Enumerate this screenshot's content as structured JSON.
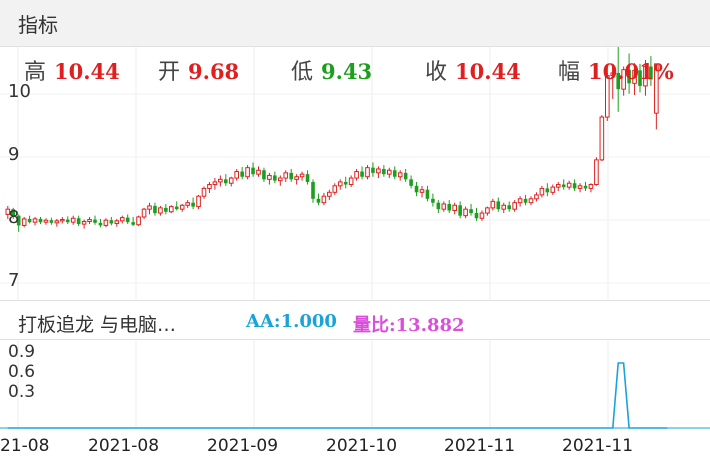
{
  "header": {
    "title": "指标"
  },
  "ohlc": {
    "high_label": "高",
    "high_value": "10.44",
    "open_label": "开",
    "open_value": "9.68",
    "low_label": "低",
    "low_value": "9.43",
    "close_label": "收",
    "close_value": "10.44",
    "range_label": "幅",
    "range_value": "10.01%"
  },
  "colors": {
    "up": "#e02020",
    "down": "#1e9e1e",
    "indicator_line": "#1aa3d9",
    "ratio": "#d94fd9"
  },
  "price_axis": {
    "labels": [
      "10",
      "9",
      "8",
      "7"
    ]
  },
  "indicator": {
    "name": "打板追龙 与电脑…",
    "aa_text": "AA:1.000",
    "ratio_text": "量比:13.882",
    "axis_labels": [
      "0.9",
      "0.6",
      "0.3"
    ]
  },
  "x_axis": {
    "labels": [
      "21-08",
      "2021-08",
      "2021-09",
      "2021-10",
      "2021-11",
      "2021-11"
    ]
  },
  "chart_data": {
    "type": "candlestick",
    "ylim": [
      6.8,
      10.7
    ],
    "candles": [
      [
        8.12,
        8.25,
        8.05,
        8.2
      ],
      [
        8.2,
        8.22,
        8.05,
        8.1
      ],
      [
        8.1,
        8.12,
        7.85,
        7.95
      ],
      [
        7.95,
        8.08,
        7.92,
        8.05
      ],
      [
        8.05,
        8.1,
        7.98,
        8.0
      ],
      [
        8.0,
        8.08,
        7.95,
        8.05
      ],
      [
        8.05,
        8.08,
        7.97,
        8.0
      ],
      [
        8.0,
        8.06,
        7.96,
        8.03
      ],
      [
        8.03,
        8.07,
        7.96,
        7.99
      ],
      [
        7.99,
        8.05,
        7.93,
        8.02
      ],
      [
        8.02,
        8.08,
        7.98,
        8.04
      ],
      [
        8.04,
        8.09,
        7.97,
        8.0
      ],
      [
        8.0,
        8.1,
        7.96,
        8.06
      ],
      [
        8.06,
        8.1,
        7.94,
        7.97
      ],
      [
        7.97,
        8.04,
        7.9,
        8.01
      ],
      [
        8.01,
        8.08,
        7.97,
        8.04
      ],
      [
        8.04,
        8.1,
        7.96,
        7.99
      ],
      [
        7.99,
        8.05,
        7.92,
        7.95
      ],
      [
        7.95,
        8.06,
        7.92,
        8.03
      ],
      [
        8.03,
        8.08,
        7.95,
        7.98
      ],
      [
        7.98,
        8.05,
        7.93,
        8.02
      ],
      [
        8.02,
        8.1,
        7.98,
        8.07
      ],
      [
        8.07,
        8.12,
        7.97,
        8.0
      ],
      [
        8.0,
        8.08,
        7.94,
        7.96
      ],
      [
        7.96,
        8.1,
        7.94,
        8.08
      ],
      [
        8.08,
        8.22,
        8.05,
        8.2
      ],
      [
        8.2,
        8.3,
        8.12,
        8.25
      ],
      [
        8.25,
        8.3,
        8.1,
        8.14
      ],
      [
        8.14,
        8.25,
        8.1,
        8.22
      ],
      [
        8.22,
        8.28,
        8.12,
        8.16
      ],
      [
        8.16,
        8.26,
        8.14,
        8.24
      ],
      [
        8.24,
        8.32,
        8.18,
        8.2
      ],
      [
        8.2,
        8.28,
        8.16,
        8.26
      ],
      [
        8.26,
        8.34,
        8.22,
        8.3
      ],
      [
        8.3,
        8.38,
        8.2,
        8.24
      ],
      [
        8.24,
        8.42,
        8.2,
        8.4
      ],
      [
        8.4,
        8.55,
        8.36,
        8.52
      ],
      [
        8.52,
        8.62,
        8.45,
        8.58
      ],
      [
        8.58,
        8.68,
        8.5,
        8.62
      ],
      [
        8.62,
        8.72,
        8.55,
        8.66
      ],
      [
        8.66,
        8.74,
        8.56,
        8.6
      ],
      [
        8.6,
        8.7,
        8.55,
        8.68
      ],
      [
        8.68,
        8.82,
        8.64,
        8.78
      ],
      [
        8.78,
        8.85,
        8.66,
        8.7
      ],
      [
        8.7,
        8.88,
        8.66,
        8.84
      ],
      [
        8.84,
        8.92,
        8.7,
        8.74
      ],
      [
        8.74,
        8.86,
        8.7,
        8.8
      ],
      [
        8.8,
        8.84,
        8.62,
        8.66
      ],
      [
        8.66,
        8.76,
        8.58,
        8.72
      ],
      [
        8.72,
        8.78,
        8.6,
        8.64
      ],
      [
        8.64,
        8.72,
        8.56,
        8.68
      ],
      [
        8.68,
        8.8,
        8.62,
        8.76
      ],
      [
        8.76,
        8.82,
        8.62,
        8.66
      ],
      [
        8.66,
        8.74,
        8.58,
        8.7
      ],
      [
        8.7,
        8.78,
        8.64,
        8.74
      ],
      [
        8.74,
        8.8,
        8.58,
        8.62
      ],
      [
        8.62,
        8.66,
        8.3,
        8.36
      ],
      [
        8.36,
        8.44,
        8.26,
        8.3
      ],
      [
        8.3,
        8.45,
        8.26,
        8.4
      ],
      [
        8.4,
        8.5,
        8.34,
        8.46
      ],
      [
        8.46,
        8.6,
        8.42,
        8.56
      ],
      [
        8.56,
        8.66,
        8.5,
        8.62
      ],
      [
        8.62,
        8.7,
        8.52,
        8.58
      ],
      [
        8.58,
        8.72,
        8.54,
        8.68
      ],
      [
        8.68,
        8.82,
        8.64,
        8.78
      ],
      [
        8.78,
        8.86,
        8.66,
        8.7
      ],
      [
        8.7,
        8.88,
        8.66,
        8.84
      ],
      [
        8.84,
        8.92,
        8.7,
        8.76
      ],
      [
        8.76,
        8.86,
        8.68,
        8.82
      ],
      [
        8.82,
        8.88,
        8.7,
        8.74
      ],
      [
        8.74,
        8.84,
        8.68,
        8.8
      ],
      [
        8.8,
        8.86,
        8.66,
        8.7
      ],
      [
        8.7,
        8.8,
        8.64,
        8.76
      ],
      [
        8.76,
        8.82,
        8.62,
        8.66
      ],
      [
        8.66,
        8.72,
        8.52,
        8.56
      ],
      [
        8.56,
        8.62,
        8.4,
        8.46
      ],
      [
        8.46,
        8.56,
        8.38,
        8.5
      ],
      [
        8.5,
        8.56,
        8.32,
        8.36
      ],
      [
        8.36,
        8.44,
        8.24,
        8.3
      ],
      [
        8.3,
        8.34,
        8.14,
        8.2
      ],
      [
        8.2,
        8.32,
        8.16,
        8.28
      ],
      [
        8.28,
        8.34,
        8.14,
        8.18
      ],
      [
        8.18,
        8.3,
        8.12,
        8.26
      ],
      [
        8.26,
        8.32,
        8.06,
        8.1
      ],
      [
        8.1,
        8.24,
        8.06,
        8.2
      ],
      [
        8.2,
        8.28,
        8.1,
        8.14
      ],
      [
        8.14,
        8.22,
        8.02,
        8.06
      ],
      [
        8.06,
        8.18,
        8.02,
        8.14
      ],
      [
        8.14,
        8.24,
        8.1,
        8.22
      ],
      [
        8.22,
        8.36,
        8.18,
        8.32
      ],
      [
        8.32,
        8.38,
        8.16,
        8.2
      ],
      [
        8.2,
        8.3,
        8.14,
        8.26
      ],
      [
        8.26,
        8.32,
        8.16,
        8.2
      ],
      [
        8.2,
        8.34,
        8.16,
        8.3
      ],
      [
        8.3,
        8.4,
        8.24,
        8.36
      ],
      [
        8.36,
        8.42,
        8.26,
        8.3
      ],
      [
        8.3,
        8.4,
        8.26,
        8.36
      ],
      [
        8.36,
        8.46,
        8.32,
        8.42
      ],
      [
        8.42,
        8.56,
        8.38,
        8.52
      ],
      [
        8.52,
        8.6,
        8.4,
        8.46
      ],
      [
        8.46,
        8.58,
        8.42,
        8.54
      ],
      [
        8.54,
        8.62,
        8.48,
        8.58
      ],
      [
        8.58,
        8.66,
        8.5,
        8.54
      ],
      [
        8.54,
        8.64,
        8.5,
        8.6
      ],
      [
        8.6,
        8.66,
        8.48,
        8.52
      ],
      [
        8.52,
        8.6,
        8.46,
        8.56
      ],
      [
        8.56,
        8.62,
        8.48,
        8.52
      ],
      [
        8.52,
        8.6,
        8.46,
        8.58
      ],
      [
        8.58,
        9.0,
        8.56,
        8.96
      ],
      [
        8.96,
        9.65,
        8.94,
        9.62
      ],
      [
        9.62,
        10.3,
        9.56,
        10.26
      ],
      [
        10.26,
        10.44,
        9.9,
        10.3
      ],
      [
        10.3,
        10.7,
        9.7,
        10.05
      ],
      [
        10.05,
        10.4,
        9.95,
        10.35
      ],
      [
        10.35,
        10.6,
        9.98,
        10.14
      ],
      [
        10.14,
        10.45,
        9.96,
        10.34
      ],
      [
        10.34,
        10.44,
        10.0,
        10.1
      ],
      [
        10.1,
        10.5,
        9.95,
        10.4
      ],
      [
        10.4,
        10.56,
        10.1,
        10.2
      ],
      [
        9.68,
        10.44,
        9.43,
        10.44
      ]
    ],
    "indicator_series": [
      0,
      0,
      0,
      0,
      0,
      0,
      0,
      0,
      0,
      0,
      0,
      0,
      0,
      0,
      0,
      0,
      0,
      0,
      0,
      0,
      0,
      0,
      0,
      0,
      0,
      0,
      0,
      0,
      0,
      0,
      0,
      0,
      0,
      0,
      0,
      0,
      0,
      0,
      0,
      0,
      0,
      0,
      0,
      0,
      0,
      0,
      0,
      0,
      0,
      0,
      0,
      0,
      0,
      0,
      0,
      0,
      0,
      0,
      0,
      0,
      0,
      0,
      0,
      0,
      0,
      0,
      0,
      0,
      0,
      0,
      0,
      0,
      0,
      0,
      0,
      0,
      0,
      0,
      0,
      0,
      0,
      0,
      0,
      0,
      0,
      0,
      0,
      0,
      0,
      0,
      0,
      0,
      0,
      0,
      0,
      0,
      0,
      0,
      0,
      0,
      0,
      0,
      0,
      0,
      0,
      0,
      0,
      0,
      0,
      0,
      0,
      0,
      1,
      1,
      0,
      0,
      0,
      0,
      0,
      0,
      0,
      0
    ],
    "indicator_ylim": [
      0,
      1.2
    ]
  }
}
